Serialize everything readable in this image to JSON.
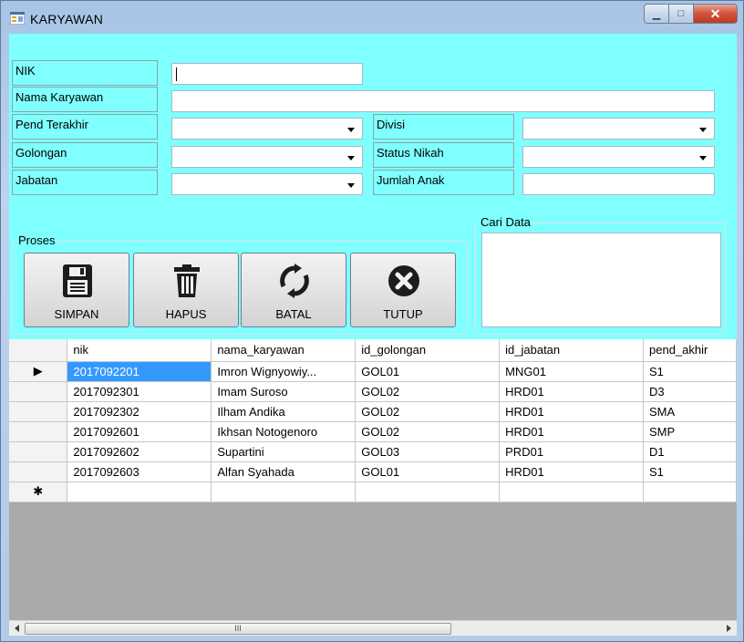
{
  "window": {
    "title": "KARYAWAN",
    "minimize": "▁",
    "maximize": "□",
    "close": "✕"
  },
  "form": {
    "nik_label": "NIK",
    "nik_value": "",
    "nama_label": "Nama Karyawan",
    "nama_value": "",
    "pend_label": "Pend Terakhir",
    "pend_value": "",
    "golongan_label": "Golongan",
    "golongan_value": "",
    "jabatan_label": "Jabatan",
    "jabatan_value": "",
    "divisi_label": "Divisi",
    "divisi_value": "",
    "status_label": "Status Nikah",
    "status_value": "",
    "anak_label": "Jumlah Anak",
    "anak_value": ""
  },
  "proses": {
    "legend": "Proses",
    "simpan": "SIMPAN",
    "hapus": "HAPUS",
    "batal": "BATAL",
    "tutup": "TUTUP"
  },
  "cari": {
    "legend": "Cari Data"
  },
  "grid": {
    "columns": [
      "nik",
      "nama_karyawan",
      "id_golongan",
      "id_jabatan",
      "pend_akhir"
    ],
    "rows": [
      [
        "2017092201",
        "Imron Wignyowiy...",
        "GOL01",
        "MNG01",
        "S1"
      ],
      [
        "2017092301",
        "Imam Suroso",
        "GOL02",
        "HRD01",
        "D3"
      ],
      [
        "2017092302",
        "Ilham Andika",
        "GOL02",
        "HRD01",
        "SMA"
      ],
      [
        "2017092601",
        "Ikhsan Notogenoro",
        "GOL02",
        "HRD01",
        "SMP"
      ],
      [
        "2017092602",
        "Supartini",
        "GOL03",
        "PRD01",
        "D1"
      ],
      [
        "2017092603",
        "Alfan Syahada",
        "GOL01",
        "HRD01",
        "S1"
      ]
    ],
    "current_row_marker": "▶",
    "new_row_marker": "✱",
    "scroll_grip": "III"
  },
  "colors": {
    "form_background": "#80ffff",
    "grid_background": "#aaaaaa",
    "selection": "#3399ff"
  }
}
